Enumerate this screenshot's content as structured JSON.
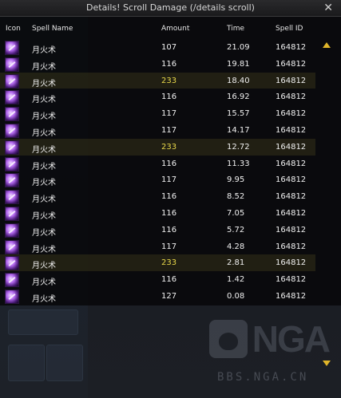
{
  "window": {
    "title": "Details! Scroll Damage (/details scroll)",
    "close_label": "✕"
  },
  "columns": [
    "Icon",
    "Spell Name",
    "Amount",
    "Time",
    "Spell ID"
  ],
  "rows": [
    {
      "name": "月火术",
      "amount": "107",
      "time": "21.09",
      "id": "164812",
      "highlight": false
    },
    {
      "name": "月火术",
      "amount": "116",
      "time": "19.81",
      "id": "164812",
      "highlight": false
    },
    {
      "name": "月火术",
      "amount": "233",
      "time": "18.40",
      "id": "164812",
      "highlight": true
    },
    {
      "name": "月火术",
      "amount": "116",
      "time": "16.92",
      "id": "164812",
      "highlight": false
    },
    {
      "name": "月火术",
      "amount": "117",
      "time": "15.57",
      "id": "164812",
      "highlight": false
    },
    {
      "name": "月火术",
      "amount": "117",
      "time": "14.17",
      "id": "164812",
      "highlight": false
    },
    {
      "name": "月火术",
      "amount": "233",
      "time": "12.72",
      "id": "164812",
      "highlight": true
    },
    {
      "name": "月火术",
      "amount": "116",
      "time": "11.33",
      "id": "164812",
      "highlight": false
    },
    {
      "name": "月火术",
      "amount": "117",
      "time": "9.95",
      "id": "164812",
      "highlight": false
    },
    {
      "name": "月火术",
      "amount": "116",
      "time": "8.52",
      "id": "164812",
      "highlight": false
    },
    {
      "name": "月火术",
      "amount": "116",
      "time": "7.05",
      "id": "164812",
      "highlight": false
    },
    {
      "name": "月火术",
      "amount": "116",
      "time": "5.72",
      "id": "164812",
      "highlight": false
    },
    {
      "name": "月火术",
      "amount": "117",
      "time": "4.28",
      "id": "164812",
      "highlight": false
    },
    {
      "name": "月火术",
      "amount": "233",
      "time": "2.81",
      "id": "164812",
      "highlight": true
    },
    {
      "name": "月火术",
      "amount": "116",
      "time": "1.42",
      "id": "164812",
      "highlight": false
    },
    {
      "name": "月火术",
      "amount": "127",
      "time": "0.08",
      "id": "164812",
      "highlight": false
    }
  ],
  "icons": {
    "row_icon": "moonfire-spell-icon"
  },
  "colors": {
    "crit_amount": "#e8d84a",
    "scroll_arrow": "#e0b52a"
  },
  "watermark": {
    "logo_text": "NGA",
    "url": "BBS.NGA.CN"
  }
}
